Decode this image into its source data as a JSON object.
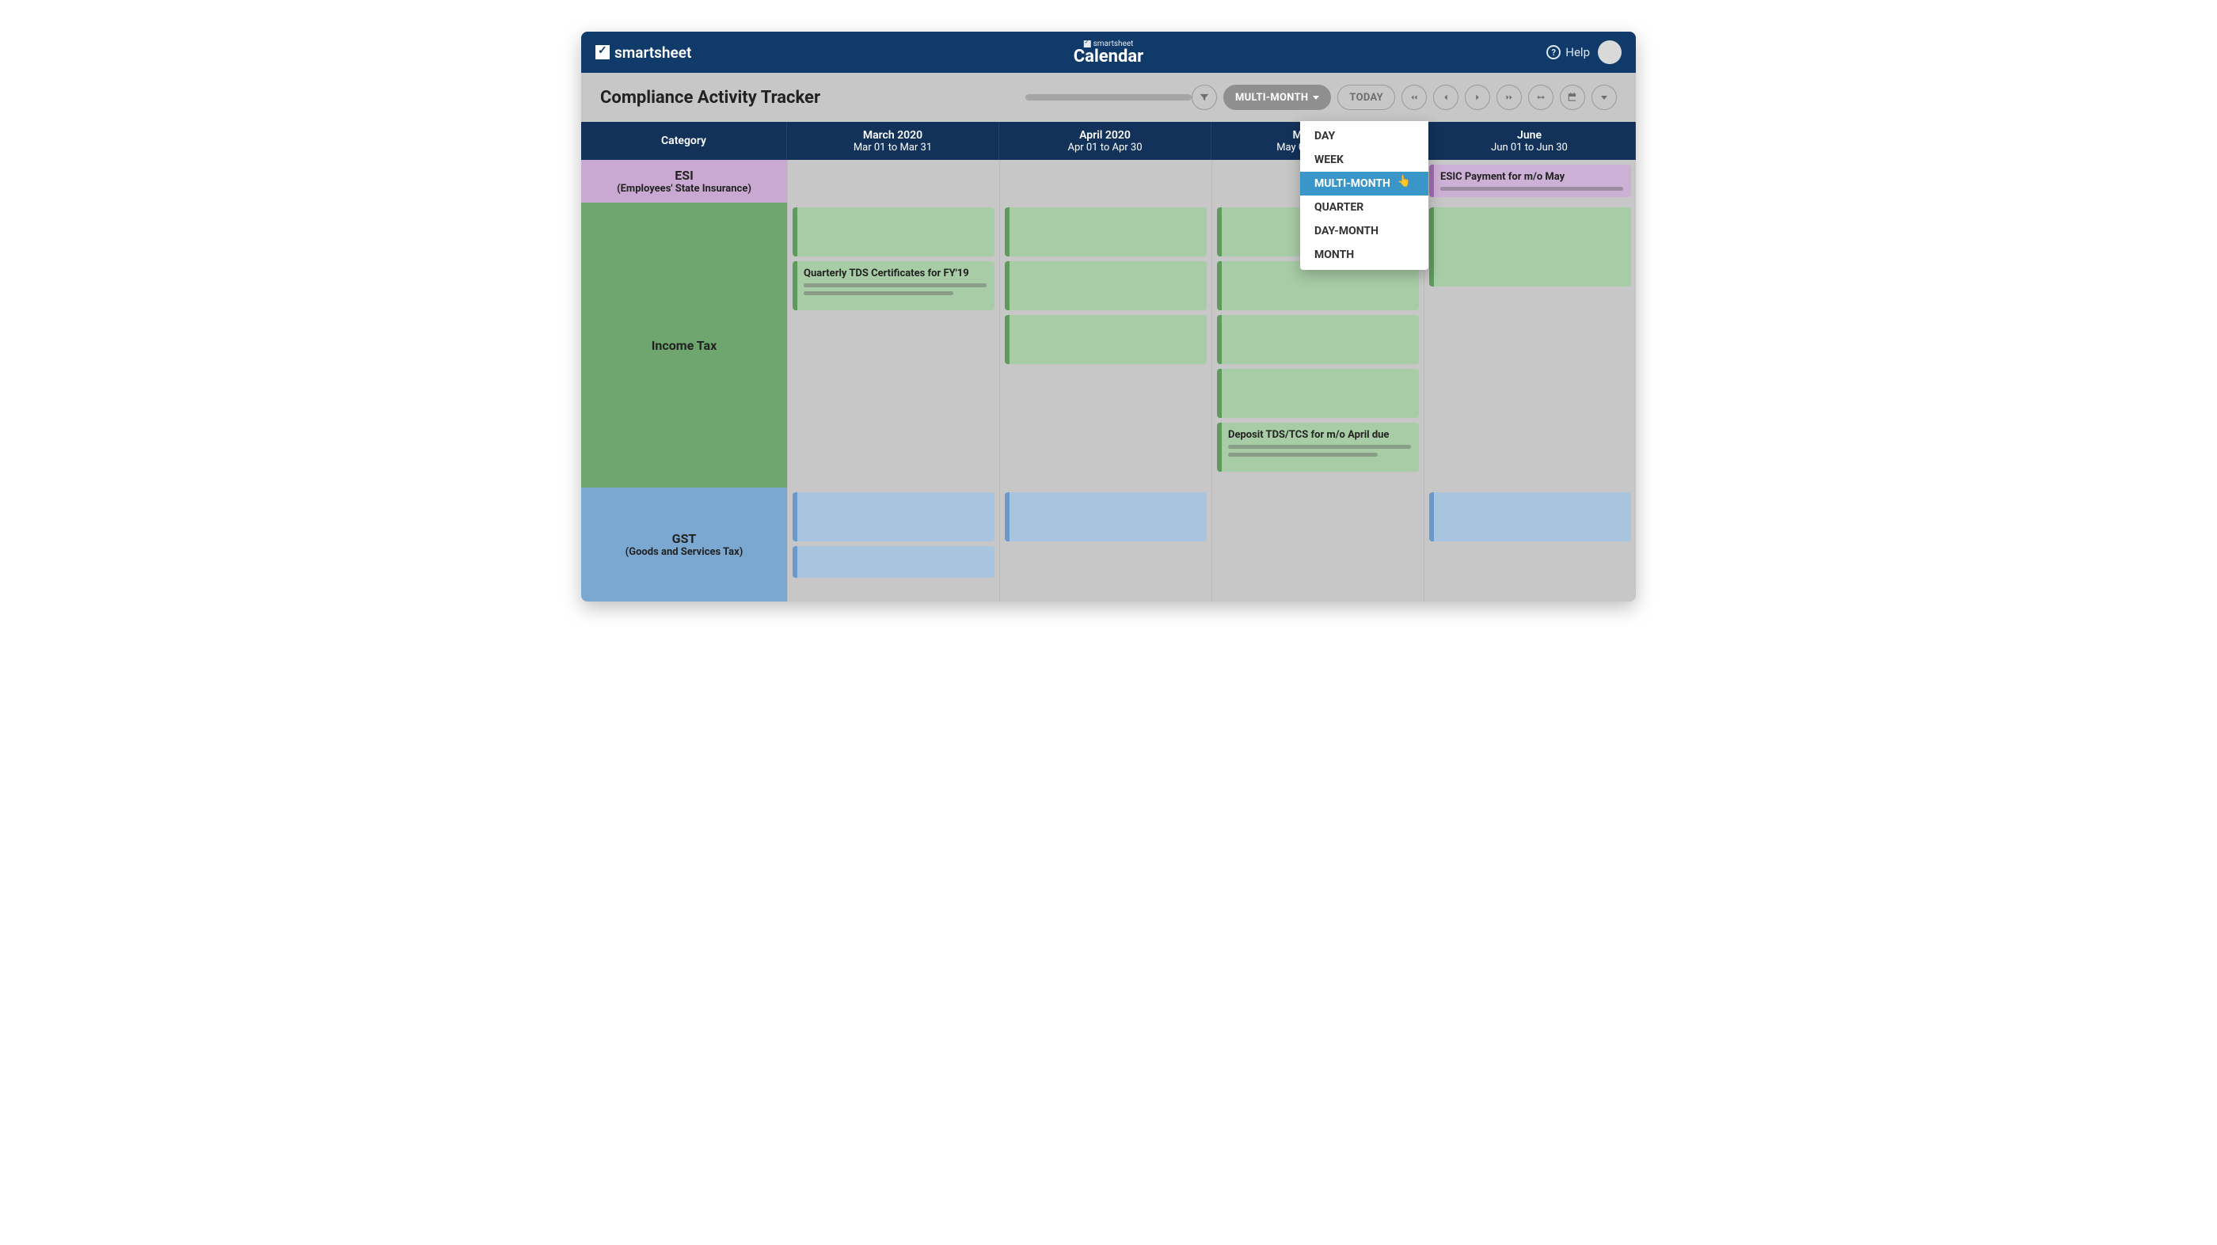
{
  "brand": {
    "name": "smartsheet",
    "app": "Calendar",
    "mini": "smartsheet"
  },
  "topbar": {
    "help": "Help"
  },
  "toolbar": {
    "title": "Compliance Activity Tracker",
    "view_label": "MULTI-MONTH",
    "today_label": "TODAY"
  },
  "dropdown": {
    "items": [
      "DAY",
      "WEEK",
      "MULTI-MONTH",
      "QUARTER",
      "DAY-MONTH",
      "MONTH"
    ],
    "selected_index": 2
  },
  "columns": {
    "category": "Category",
    "months": [
      {
        "title": "March 2020",
        "range": "Mar 01 to Mar 31"
      },
      {
        "title": "April 2020",
        "range": "Apr 01 to Apr 30"
      },
      {
        "title": "May 2020",
        "range": "May 01 to May 31"
      },
      {
        "title": "June",
        "range": "Jun 01 to Jun 30"
      }
    ]
  },
  "categories": {
    "esi": {
      "name": "ESI",
      "sub": "(Employees' State Insurance)"
    },
    "income": {
      "name": "Income Tax",
      "sub": ""
    },
    "gst": {
      "name": "GST",
      "sub": "(Goods and Services Tax)"
    }
  },
  "events": {
    "esic_may": "ESIC Payment for m/o May",
    "tds_fy19": "Quarterly TDS Certificates for FY'19",
    "deposit_tds": "Deposit TDS/TCS for m/o April due"
  }
}
